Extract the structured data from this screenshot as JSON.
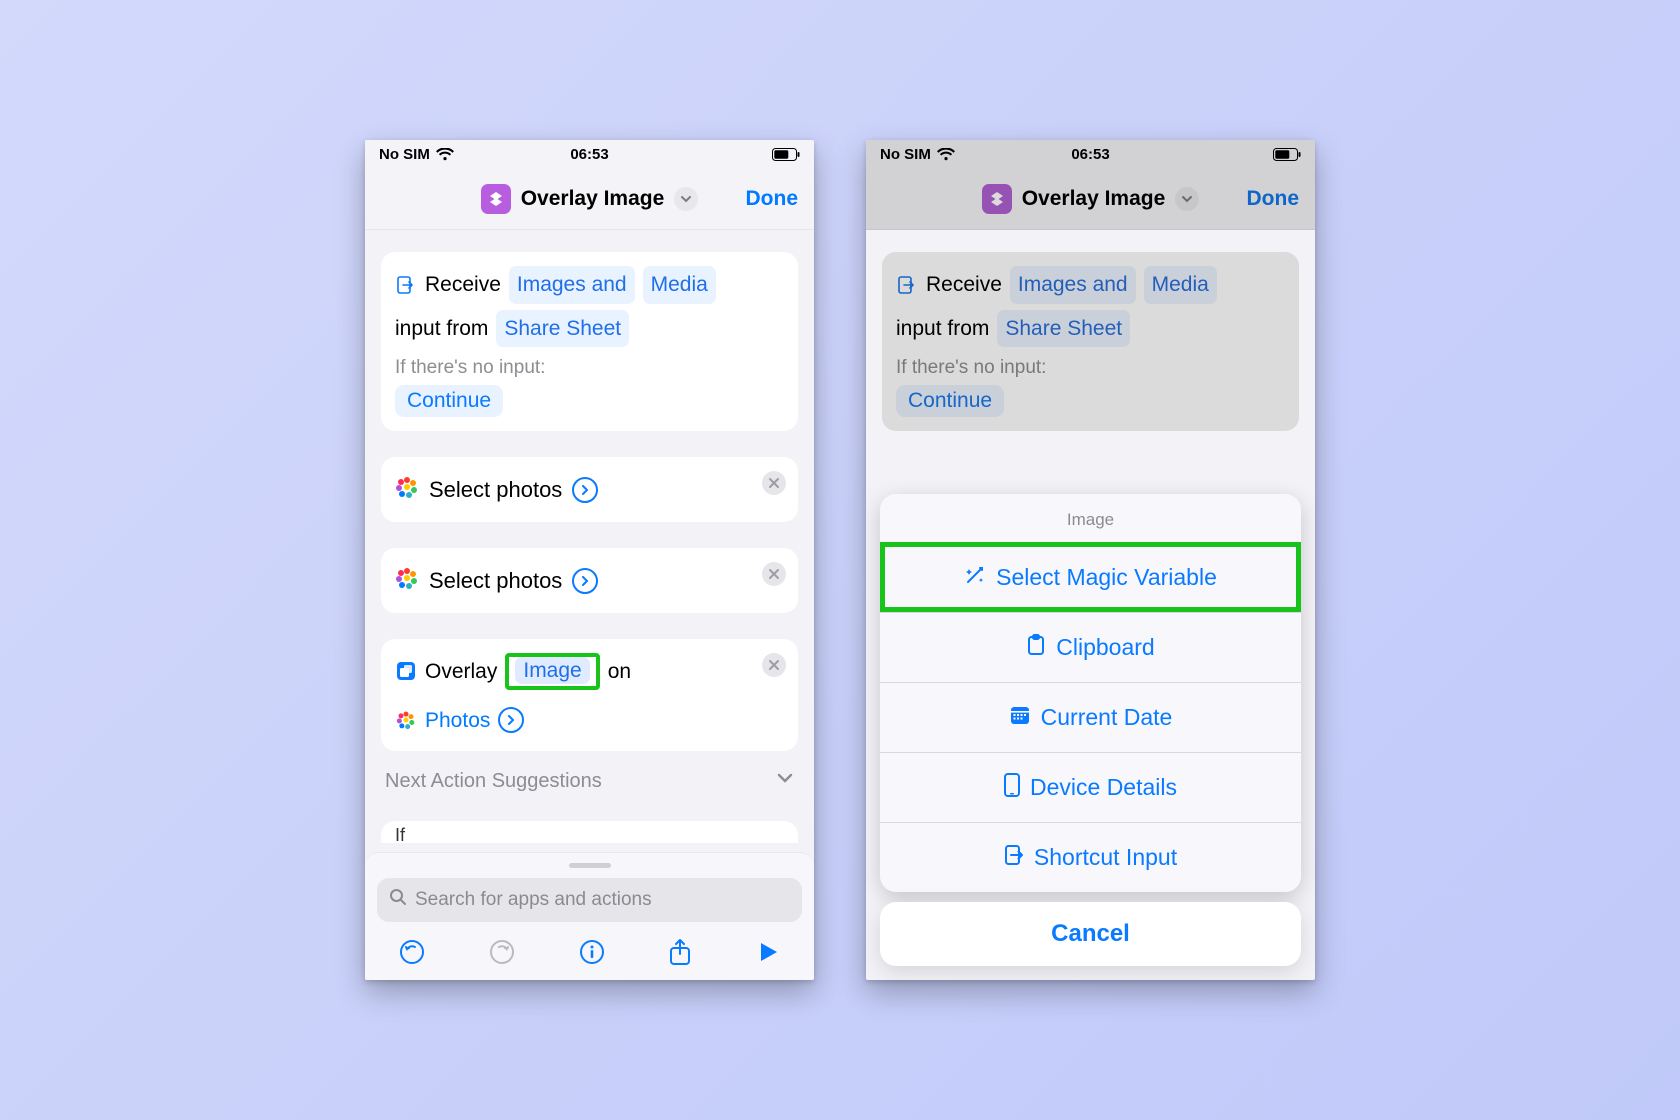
{
  "status": {
    "carrier": "No SIM",
    "time": "06:53"
  },
  "nav": {
    "title": "Overlay Image",
    "done": "Done"
  },
  "receive": {
    "w1": "Receive",
    "w2": "Images and",
    "w3": "Media",
    "w4": "input from",
    "w5": "Share Sheet",
    "noinput": "If there's no input:",
    "cont": "Continue"
  },
  "sel": {
    "label": "Select photos"
  },
  "overlay": {
    "w1": "Overlay",
    "img": "Image",
    "on": "on",
    "photos": "Photos"
  },
  "suggestions": "Next Action Suggestions",
  "peek": "If",
  "search": {
    "placeholder": "Search for apps and actions"
  },
  "sheet": {
    "header": "Image",
    "items": [
      "Select Magic Variable",
      "Clipboard",
      "Current Date",
      "Device Details",
      "Shortcut Input"
    ],
    "cancel": "Cancel"
  }
}
